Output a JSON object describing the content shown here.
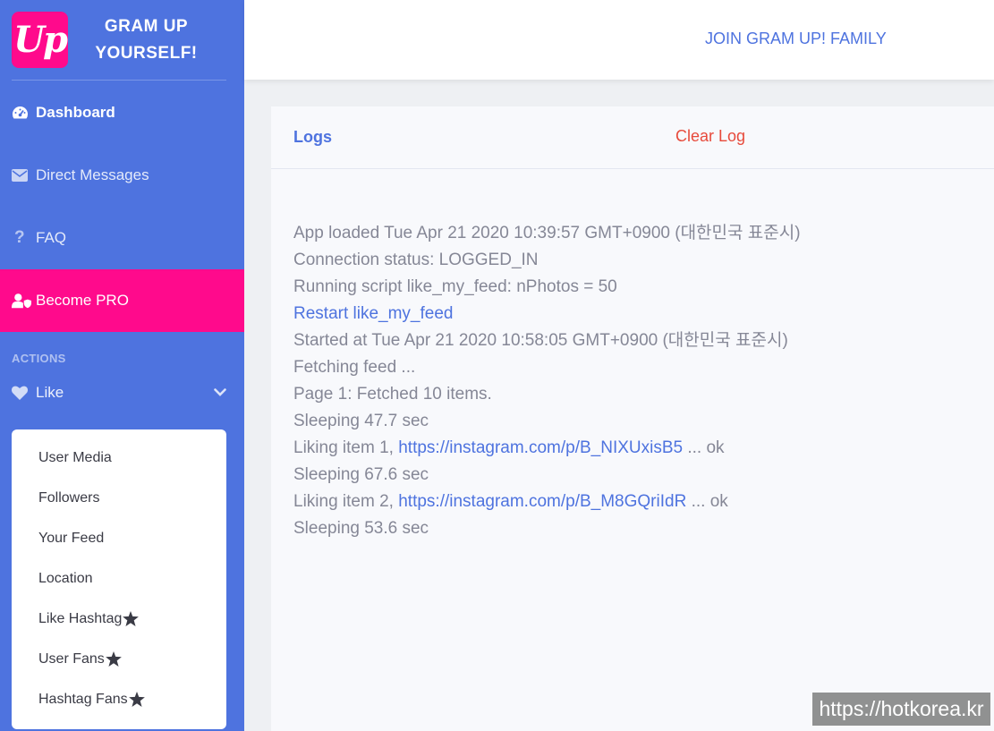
{
  "brand": {
    "logo_text": "Up",
    "name_line1": "GRAM UP",
    "name_line2": "YOURSELF!",
    "logo_color": "#ff0a8c"
  },
  "sidebar": {
    "items": [
      {
        "label": "Dashboard",
        "icon": "tachometer-icon"
      },
      {
        "label": "Direct Messages",
        "icon": "envelope-icon"
      },
      {
        "label": "FAQ",
        "icon": "question-icon"
      },
      {
        "label": "Become PRO",
        "icon": "user-shield-icon"
      }
    ],
    "section_heading": "ACTIONS",
    "like": {
      "label": "Like",
      "icon": "heart-icon",
      "expand_icon": "chevron-down-icon"
    },
    "like_submenu": [
      {
        "label": "User Media",
        "pro": false
      },
      {
        "label": "Followers",
        "pro": false
      },
      {
        "label": "Your Feed",
        "pro": false
      },
      {
        "label": "Location",
        "pro": false
      },
      {
        "label": "Like Hashtag",
        "pro": true
      },
      {
        "label": "User Fans",
        "pro": true
      },
      {
        "label": "Hashtag Fans",
        "pro": true
      }
    ],
    "colors": {
      "background": "#4e73df",
      "pro_background": "#ff0a8c"
    }
  },
  "topbar": {
    "join_link": "JOIN GRAM UP! FAMILY"
  },
  "logs": {
    "title": "Logs",
    "clear_label": "Clear Log",
    "lines": [
      {
        "text": "App loaded Tue Apr 21 2020 10:39:57 GMT+0900 (대한민국 표준시)"
      },
      {
        "text": "Connection status: LOGGED_IN"
      },
      {
        "text": "Running script like_my_feed: nPhotos = 50"
      },
      {
        "link": "Restart like_my_feed"
      },
      {
        "text": "Started at Tue Apr 21 2020 10:58:05 GMT+0900 (대한민국 표준시)"
      },
      {
        "text": "Fetching feed ..."
      },
      {
        "text": "Page 1: Fetched 10 items."
      },
      {
        "text": "Sleeping 47.7 sec"
      },
      {
        "prefix": "Liking item 1, ",
        "link": "https://instagram.com/p/B_NIXUxisB5",
        "suffix": " ... ok"
      },
      {
        "text": "Sleeping 67.6 sec"
      },
      {
        "prefix": "Liking item 2, ",
        "link": "https://instagram.com/p/B_M8GQriIdR",
        "suffix": " ... ok"
      },
      {
        "text": "Sleeping 53.6 sec"
      }
    ],
    "colors": {
      "text": "#858796",
      "link": "#4e73df",
      "clear": "#e74a3b"
    }
  },
  "watermark": "https://hotkorea.kr"
}
